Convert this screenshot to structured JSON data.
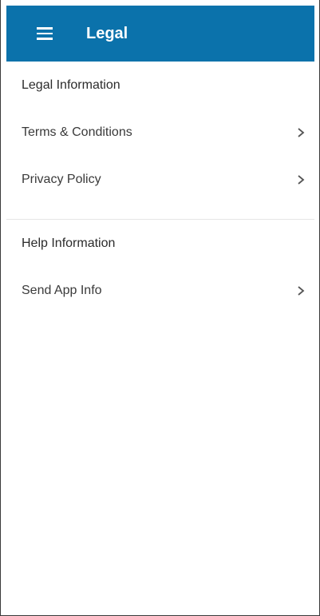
{
  "appbar": {
    "title": "Legal",
    "menu_icon": "menu-icon",
    "color": "#0b72ab"
  },
  "sections": [
    {
      "header": "Legal Information",
      "items": [
        {
          "label": "Terms & Conditions",
          "icon": "chevron-right-icon"
        },
        {
          "label": "Privacy Policy",
          "icon": "chevron-right-icon"
        }
      ]
    },
    {
      "header": "Help Information",
      "items": [
        {
          "label": "Send App Info",
          "icon": "chevron-right-icon"
        }
      ]
    }
  ]
}
